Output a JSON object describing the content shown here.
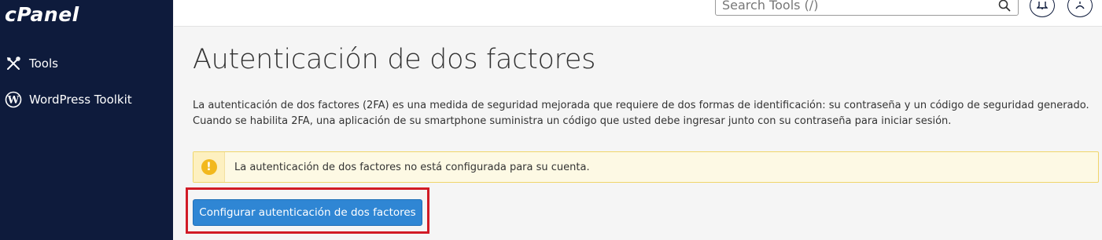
{
  "brand": {
    "logo_text": "cPanel"
  },
  "sidebar": {
    "items": [
      {
        "label": "Tools",
        "icon": "tools-icon"
      },
      {
        "label": "WordPress Toolkit",
        "icon": "wordpress-icon"
      }
    ]
  },
  "header": {
    "search_placeholder": "Search Tools (/)",
    "notifications_icon": "bell-icon",
    "user_icon": "user-icon"
  },
  "main": {
    "title": "Autenticación de dos factores",
    "description_line1": "La autenticación de dos factores (2FA) es una medida de seguridad mejorada que requiere de dos formas de identificación: su contraseña y un código de seguridad generado.",
    "description_line2": "Cuando se habilita 2FA, una aplicación de su smartphone suministra un código que usted debe ingresar junto con su contraseña para iniciar sesión.",
    "alert": {
      "icon": "exclamation-icon",
      "text": "La autenticación de dos factores no está configurada para su cuenta."
    },
    "configure_button_label": "Configurar autenticación de dos factores"
  },
  "colors": {
    "sidebar_bg": "#0e1b3c",
    "primary_button": "#2f86d4",
    "alert_bg": "#fdf9e4",
    "alert_icon": "#f2b81c",
    "highlight_border": "#d11b26"
  }
}
